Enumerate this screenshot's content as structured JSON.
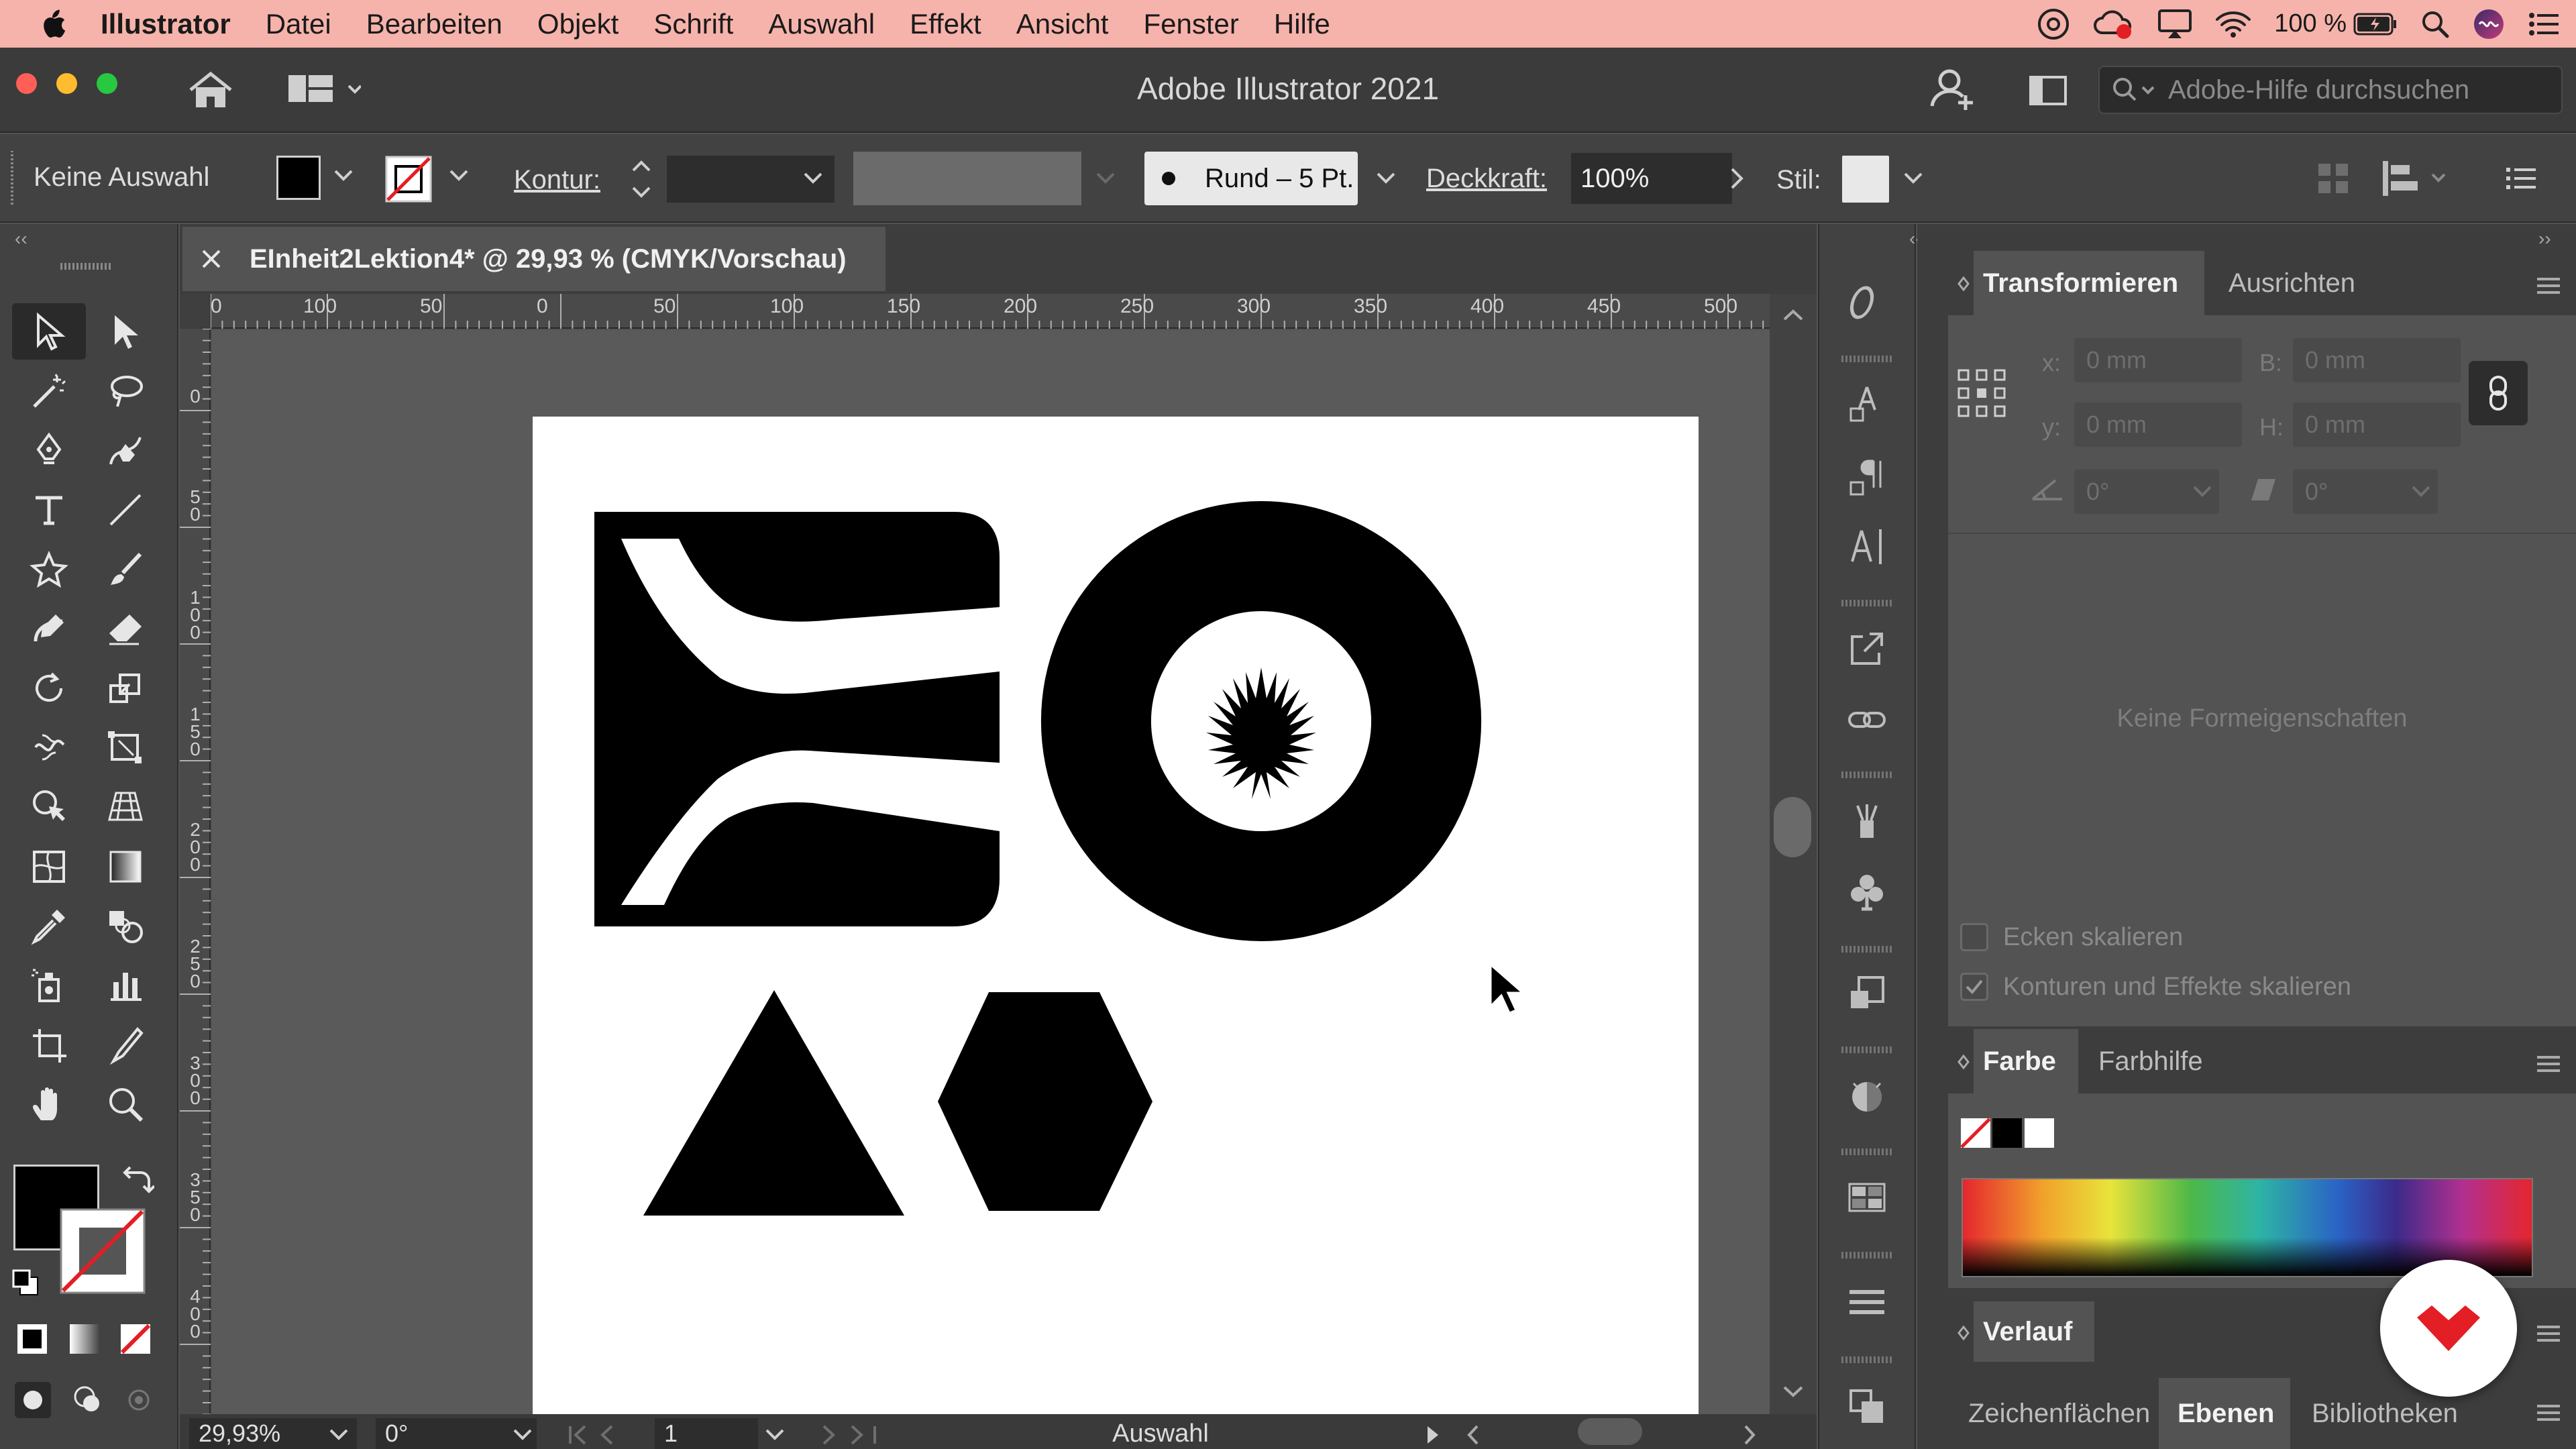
{
  "menubar": {
    "items": [
      "Illustrator",
      "Datei",
      "Bearbeiten",
      "Objekt",
      "Schrift",
      "Auswahl",
      "Effekt",
      "Ansicht",
      "Fenster",
      "Hilfe"
    ],
    "battery": "100 %"
  },
  "window": {
    "title": "Adobe Illustrator 2021",
    "search_placeholder": "Adobe-Hilfe durchsuchen"
  },
  "controlbar": {
    "selection": "Keine Auswahl",
    "stroke_label": "Kontur:",
    "brush": "Rund – 5 Pt.",
    "opacity_label": "Deckkraft:",
    "opacity_value": "100%",
    "style_label": "Stil:"
  },
  "document": {
    "tab_title": "EInheit2Lektion4* @ 29,93 % (CMYK/Vorschau)"
  },
  "rulers": {
    "top_labels": [
      "0",
      "100",
      "50",
      "0",
      "50",
      "100",
      "150",
      "200",
      "250",
      "300",
      "350",
      "400",
      "450",
      "500"
    ],
    "left_labels": [
      "0",
      "50",
      "100",
      "150",
      "200",
      "250",
      "300",
      "350",
      "400"
    ]
  },
  "statusbar": {
    "zoom": "29,93%",
    "rotation": "0°",
    "artboard": "1",
    "tool": "Auswahl"
  },
  "transform_panel": {
    "tabs": [
      "Transformieren",
      "Ausrichten"
    ],
    "x_label": "x:",
    "x_value": "0 mm",
    "y_label": "y:",
    "y_value": "0 mm",
    "w_label": "B:",
    "w_value": "0 mm",
    "h_label": "H:",
    "h_value": "0 mm",
    "angle_value": "0°",
    "shear_value": "0°",
    "empty_message": "Keine Formeigenschaften",
    "scale_corners": "Ecken skalieren",
    "scale_strokes": "Konturen und Effekte skalieren",
    "scale_strokes_checked": true
  },
  "color_panel": {
    "tabs": [
      "Farbe",
      "Farbhilfe"
    ]
  },
  "gradient_panel": {
    "title": "Verlauf"
  },
  "bottom_tabs": [
    "Zeichenflächen",
    "Ebenen",
    "Bibliotheken"
  ],
  "colors": {
    "menubar": "#f6b3ab",
    "panel_bg": "#535353",
    "accent_red": "#e31e24"
  }
}
